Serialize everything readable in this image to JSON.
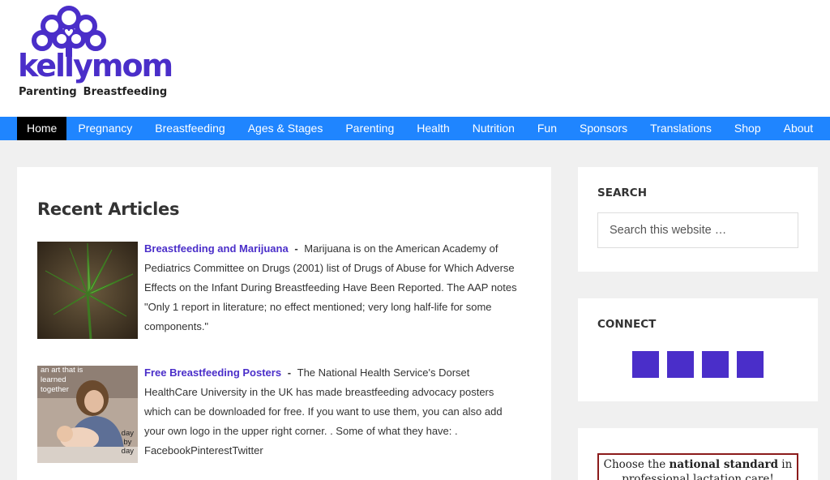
{
  "logo": {
    "wordmark": "kellymom",
    "tagline_left": "Parenting",
    "tagline_right": "Breastfeeding",
    "brand_color": "#4a2ec9"
  },
  "nav": {
    "accent_color": "#1f85ff",
    "items": [
      "Home",
      "Pregnancy",
      "Breastfeeding",
      "Ages & Stages",
      "Parenting",
      "Health",
      "Nutrition",
      "Fun",
      "Sponsors",
      "Translations",
      "Shop",
      "About"
    ],
    "active": "Home"
  },
  "main": {
    "title": "Recent Articles",
    "articles": [
      {
        "title": "Breastfeeding and Marijuana",
        "excerpt": "Marijuana is on the American Academy of Pediatrics Committee on Drugs (2001) list of Drugs of Abuse for Which Adverse Effects on the Infant During Breastfeeding Have Been Reported. The AAP notes \"Only 1 report in literature; no effect mentioned; very long half-life for some components.\"",
        "thumb_icon": "marijuana-leaf-photo"
      },
      {
        "title": "Free Breastfeeding Posters",
        "excerpt": "The National Health Service's Dorset HealthCare University in the UK has made breastfeeding advocacy posters which can be downloaded for free. If you want to use them, you can also add your own logo in the upper right corner. . Some of what they have: . FacebookPinterestTwitter",
        "thumb_icon": "breastfeeding-poster-photo",
        "thumb_text_top": [
          "an art that is",
          "learned",
          "together"
        ],
        "thumb_text_bottom": [
          "day",
          "by",
          "day"
        ]
      }
    ]
  },
  "sidebar": {
    "search": {
      "title": "SEARCH",
      "placeholder": "Search this website …"
    },
    "connect": {
      "title": "CONNECT",
      "icons": [
        "facebook-icon",
        "pinterest-icon",
        "twitter-icon",
        "youtube-icon"
      ]
    },
    "ad": {
      "line1_prefix": "Choose the ",
      "line1_bold": "national standard",
      "line1_suffix": " in",
      "line2": "professional lactation care!"
    }
  }
}
